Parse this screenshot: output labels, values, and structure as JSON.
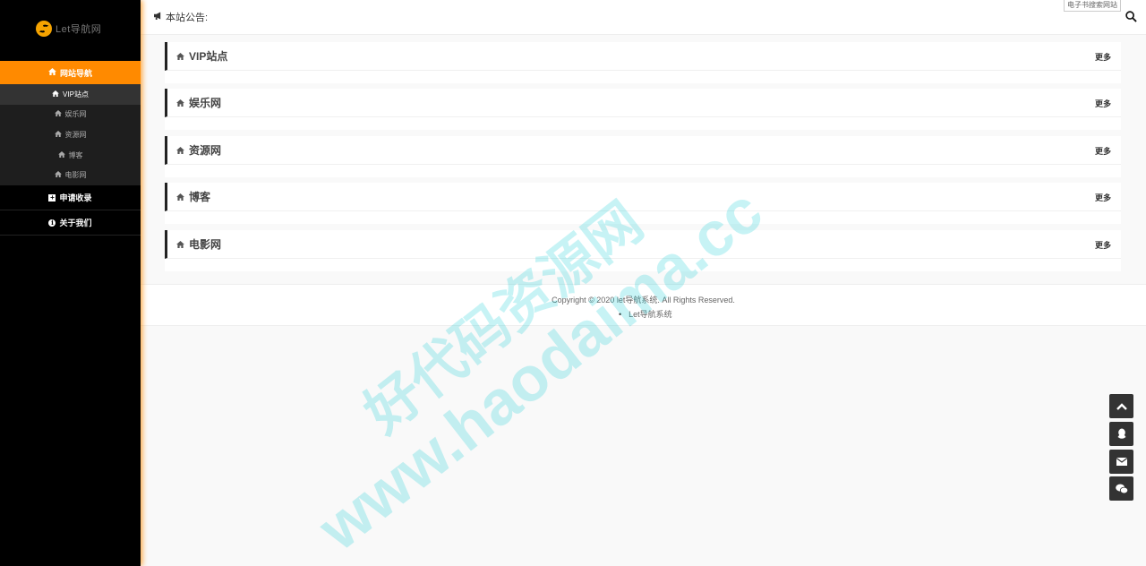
{
  "sidebar": {
    "logo_text": "Let导航网",
    "main_nav": "网站导航",
    "sub_items": [
      "VIP站点",
      "娱乐网",
      "资源网",
      "博客",
      "电影网"
    ],
    "apply_label": "申请收录",
    "about_label": "关于我们"
  },
  "topbar": {
    "notice_label": "本站公告:",
    "search_tip": "电子书搜索网站"
  },
  "sections": [
    {
      "title": "VIP站点",
      "more": "更多"
    },
    {
      "title": "娱乐网",
      "more": "更多"
    },
    {
      "title": "资源网",
      "more": "更多"
    },
    {
      "title": "博客",
      "more": "更多"
    },
    {
      "title": "电影网",
      "more": "更多"
    }
  ],
  "footer": {
    "copyright": "Copyright © 2020 let导航系统. All Rights Reserved.",
    "link": "Let导航系统"
  },
  "watermark": {
    "line1": "好代码资源网",
    "line2": "www.haodaima.cc"
  },
  "colors": {
    "accent": "#ff8a00",
    "sidebar_bg": "#000000",
    "float_btn": "#333333"
  }
}
